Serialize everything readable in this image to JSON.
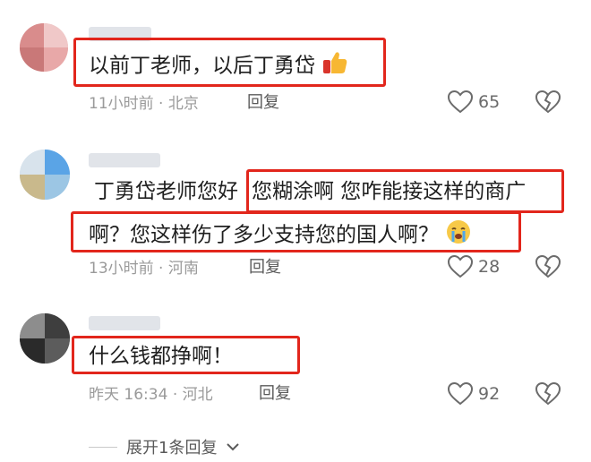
{
  "comments": [
    {
      "text": "以前丁老师，以后丁勇岱",
      "time": "11小时前",
      "location": "北京",
      "reply_label": "回复",
      "likes": "65",
      "emoji": "thumbs-up-icon"
    },
    {
      "text_line1_a": "丁勇岱老师您好",
      "text_line1_b": "您糊涂啊 您咋能接这样的商广",
      "text_line2": "啊？您这样伤了多少支持您的国人啊？",
      "time": "13小时前",
      "location": "河南",
      "reply_label": "回复",
      "likes": "28",
      "emoji": "crying-face-icon"
    },
    {
      "text": "什么钱都挣啊！",
      "time": "昨天 16:34",
      "location": "河北",
      "reply_label": "回复",
      "likes": "92"
    }
  ],
  "expand_label": "展开1条回复",
  "colors": {
    "highlight_box": "#e2261c",
    "meta_text": "#9a9a9a",
    "body_text": "#1f1f1f"
  }
}
